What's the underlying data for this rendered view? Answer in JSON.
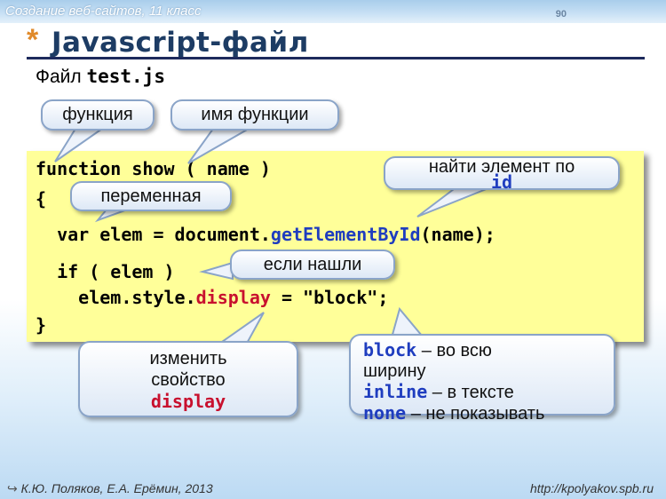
{
  "header": {
    "course": "Создание веб-сайтов, 11 класс",
    "page_number": "90"
  },
  "title": {
    "bullet": "*",
    "text": "Javascript-файл"
  },
  "subtitle": {
    "prefix": "Файл ",
    "filename": "test.js"
  },
  "code": {
    "line1": "function show ( name )",
    "line2": "{",
    "line3_prefix": "  var elem = document.",
    "line3_method": "getElementById",
    "line3_suffix": "(name);",
    "line4": "  if ( elem )",
    "line5_prefix": "    elem.style.",
    "line5_prop": "display",
    "line5_suffix": " = \"block\";",
    "line6": "}"
  },
  "callouts": {
    "function_word": "функция",
    "function_name": "имя функции",
    "variable": "переменная",
    "find_element_line1": "найти элемент по",
    "find_element_line2": "id",
    "if_found": "если нашли",
    "change_line1": "изменить",
    "change_line2": "свойство",
    "change_line3": "display",
    "block_kw": "block",
    "block_desc_a": " – во всю",
    "block_desc_b": "ширину",
    "inline_kw": "inline",
    "inline_desc": " – в тексте",
    "none_kw": "none",
    "none_desc": " – не показывать"
  },
  "footer": {
    "authors": "К.Ю. Поляков, Е.А. Ерёмин, 2013",
    "url": "http://kpolyakov.spb.ru"
  },
  "colors": {
    "accent_orange": "#e08a2b",
    "title_navy": "#1d3c64",
    "code_background": "#ffff99",
    "keyword_blue": "#1f3dbf",
    "keyword_red": "#c8102e"
  }
}
